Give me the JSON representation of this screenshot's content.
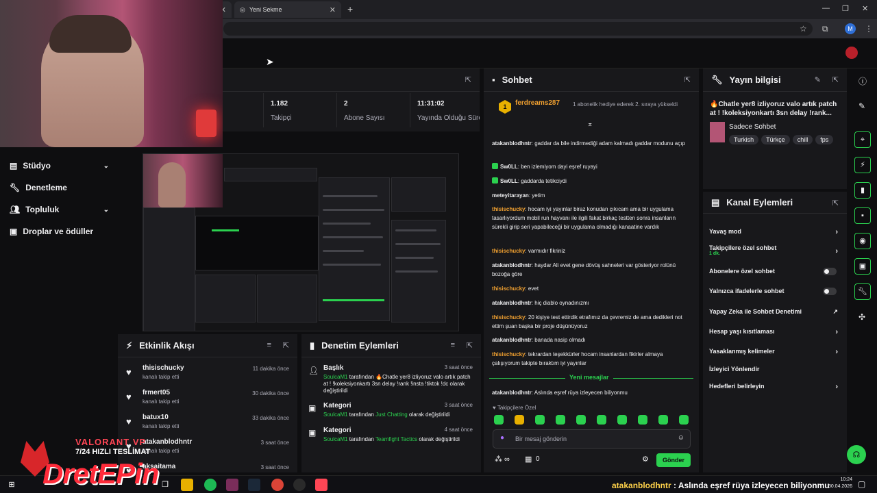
{
  "browser": {
    "tab2_title": "Yeni Sekme",
    "avatar_letter": "M"
  },
  "leftnav": {
    "items": [
      {
        "label": "Stüdyo"
      },
      {
        "label": "Denetleme"
      },
      {
        "label": "Topluluk"
      },
      {
        "label": "Droplar ve ödüller"
      }
    ]
  },
  "stats": {
    "cells": [
      {
        "value": "1.182",
        "label": "Takipçi"
      },
      {
        "value": "2",
        "label": "Abone Sayısı"
      },
      {
        "value": "11:31:02",
        "label": "Yayında Olduğu Süre"
      }
    ]
  },
  "activity": {
    "title": "Etkinlik Akışı",
    "items": [
      {
        "user": "thisischucky",
        "action": "kanalı takip etti",
        "time": "11 dakika önce"
      },
      {
        "user": "frmert05",
        "action": "kanalı takip etti",
        "time": "30 dakika önce"
      },
      {
        "user": "batux10",
        "action": "kanalı takip etti",
        "time": "33 dakika önce"
      },
      {
        "user": "atakanblodhntr",
        "action": "kanalı takip etti",
        "time": "3 saat önce"
      },
      {
        "user": "aksaitama",
        "action": "",
        "time": "3 saat önce"
      }
    ]
  },
  "modlog": {
    "title": "Denetim Eylemleri",
    "items": [
      {
        "title": "Başlık",
        "by": "SoulcaM1",
        "mid": " tarafından ",
        "value": "🔥Chatle yer8 izliyoruz valo artık patch at ! !koleksiyonkartı 3sn delay !rank !insta !tiktok !dc",
        "end": " olarak değiştirildi",
        "time": "3 saat önce"
      },
      {
        "title": "Kategori",
        "by": "SoulcaM1",
        "mid": " tarafından ",
        "value": "Just Chatting",
        "end": " olarak değiştirildi",
        "time": "3 saat önce"
      },
      {
        "title": "Kategori",
        "by": "SoulcaM1",
        "mid": " tarafından ",
        "value": "Teamfight Tactics",
        "end": " olarak değiştirildi",
        "time": "4 saat önce"
      }
    ]
  },
  "chat": {
    "title": "Sohbet",
    "pinned": {
      "user": "ferdreams287",
      "count": "1",
      "text": "1 abonelik hediye ederek 2. sıraya yükseldi"
    },
    "messages": [
      {
        "user": "atakanblodhntr",
        "color": "#efeff1",
        "badge": false,
        "text": "gaddar da bile indirmediği adam kalmadı gaddar modunu açıp"
      },
      {
        "user": "Sw0LL",
        "color": "#efeff1",
        "badge": true,
        "text": "ben izlemiyom dayi eşref ruyayi"
      },
      {
        "user": "Sw0LL",
        "color": "#efeff1",
        "badge": true,
        "text": "gaddarda tetikciydi"
      },
      {
        "user": "meteyitarayan",
        "color": "#efeff1",
        "badge": false,
        "text": "yetim"
      },
      {
        "user": "thisischucky",
        "color": "#f0a030",
        "badge": false,
        "text": "hocam iyi yayınlar biraz konudan çıkıcam ama bir uygulama tasarlıyordum mobil run hayvanı ile ilgili fakat birkaç testten sonra insanların sürekli girip seri yapabileceği bir uygulama olmadığı kanaatine vardık"
      },
      {
        "user": "thisischucky",
        "color": "#f0a030",
        "badge": false,
        "text": "varmıdır fikriniz"
      },
      {
        "user": "atakanblodhntr",
        "color": "#efeff1",
        "badge": false,
        "text": "haydar Ali evet gene dövüş sahneleri var gösteriyor rolünü bozoğa göre"
      },
      {
        "user": "thisischucky",
        "color": "#f0a030",
        "badge": false,
        "text": "evet"
      },
      {
        "user": "atakanblodhntr",
        "color": "#efeff1",
        "badge": false,
        "text": "hiç diablo oynadınızmı"
      },
      {
        "user": "thisischucky",
        "color": "#f0a030",
        "badge": false,
        "text": "20 kişiye test ettirdik etrafımız da çevremiz de ama dedikleri not ettim şuan başka bir proje düşünüyoruz"
      },
      {
        "user": "atakanblodhntr",
        "color": "#efeff1",
        "badge": false,
        "text": "banada nasip olmadı"
      },
      {
        "user": "thisischucky",
        "color": "#f0a030",
        "badge": false,
        "text": "tekrardan teşekkürler hocam insanlardan fikirler almaya çalışıyorum takipte bıraktım iyi yayınlar"
      }
    ],
    "new_messages_label": "Yeni mesajlar",
    "last_message": {
      "user": "atakanblodhntr",
      "text": "Aslında eşref rüya izleyecen biliyonmu"
    },
    "followers_only": "Takipçilere Özel",
    "placeholder": "Bir mesaj gönderin",
    "points": "0",
    "send_label": "Gönder"
  },
  "streaminfo": {
    "title": "Yayın bilgisi",
    "stream_title": "🔥Chatle yer8 izliyoruz valo artık patch at ! !koleksiyonkartı 3sn delay !rank...",
    "category": "Sadece Sohbet",
    "tags": [
      "Turkish",
      "Türkçe",
      "chill",
      "fps"
    ]
  },
  "channel_actions": {
    "title": "Kanal Eylemleri",
    "items": [
      {
        "label": "Yavaş mod",
        "sub": "",
        "kind": "chevron"
      },
      {
        "label": "Takipçilere özel sohbet",
        "sub": "1 dk.",
        "kind": "chevron"
      },
      {
        "label": "Abonelere özel sohbet",
        "sub": "",
        "kind": "toggle"
      },
      {
        "label": "Yalnızca ifadelerle sohbet",
        "sub": "",
        "kind": "toggle"
      },
      {
        "label": "Yapay Zeka ile Sohbet Denetimi",
        "sub": "",
        "kind": "external"
      },
      {
        "label": "Hesap yaşı kısıtlaması",
        "sub": "",
        "kind": "chevron"
      },
      {
        "label": "Yasaklanmış kelimeler",
        "sub": "",
        "kind": "chevron"
      },
      {
        "label": "İzleyici Yönlendir",
        "sub": "",
        "kind": "none"
      },
      {
        "label": "Hedefleri belirleyin",
        "sub": "",
        "kind": "chevron"
      }
    ]
  },
  "overlay": {
    "brand_game": "VALORANT VP",
    "brand_tag": "7/24 HIZLI TESLİMAT",
    "brand_logo": "DretEPin",
    "ticker_user": "atakanblodhntr",
    "ticker_text": " : Aslında eşref rüya izleyecen biliyonmu"
  },
  "taskbar": {
    "time": "10:24",
    "date": "30.04.2026"
  },
  "colors": {
    "accent_green": "#2bd14f",
    "chat_highlight": "#f0a030",
    "panel_bg": "#18181b",
    "page_bg": "#0e0e10"
  }
}
